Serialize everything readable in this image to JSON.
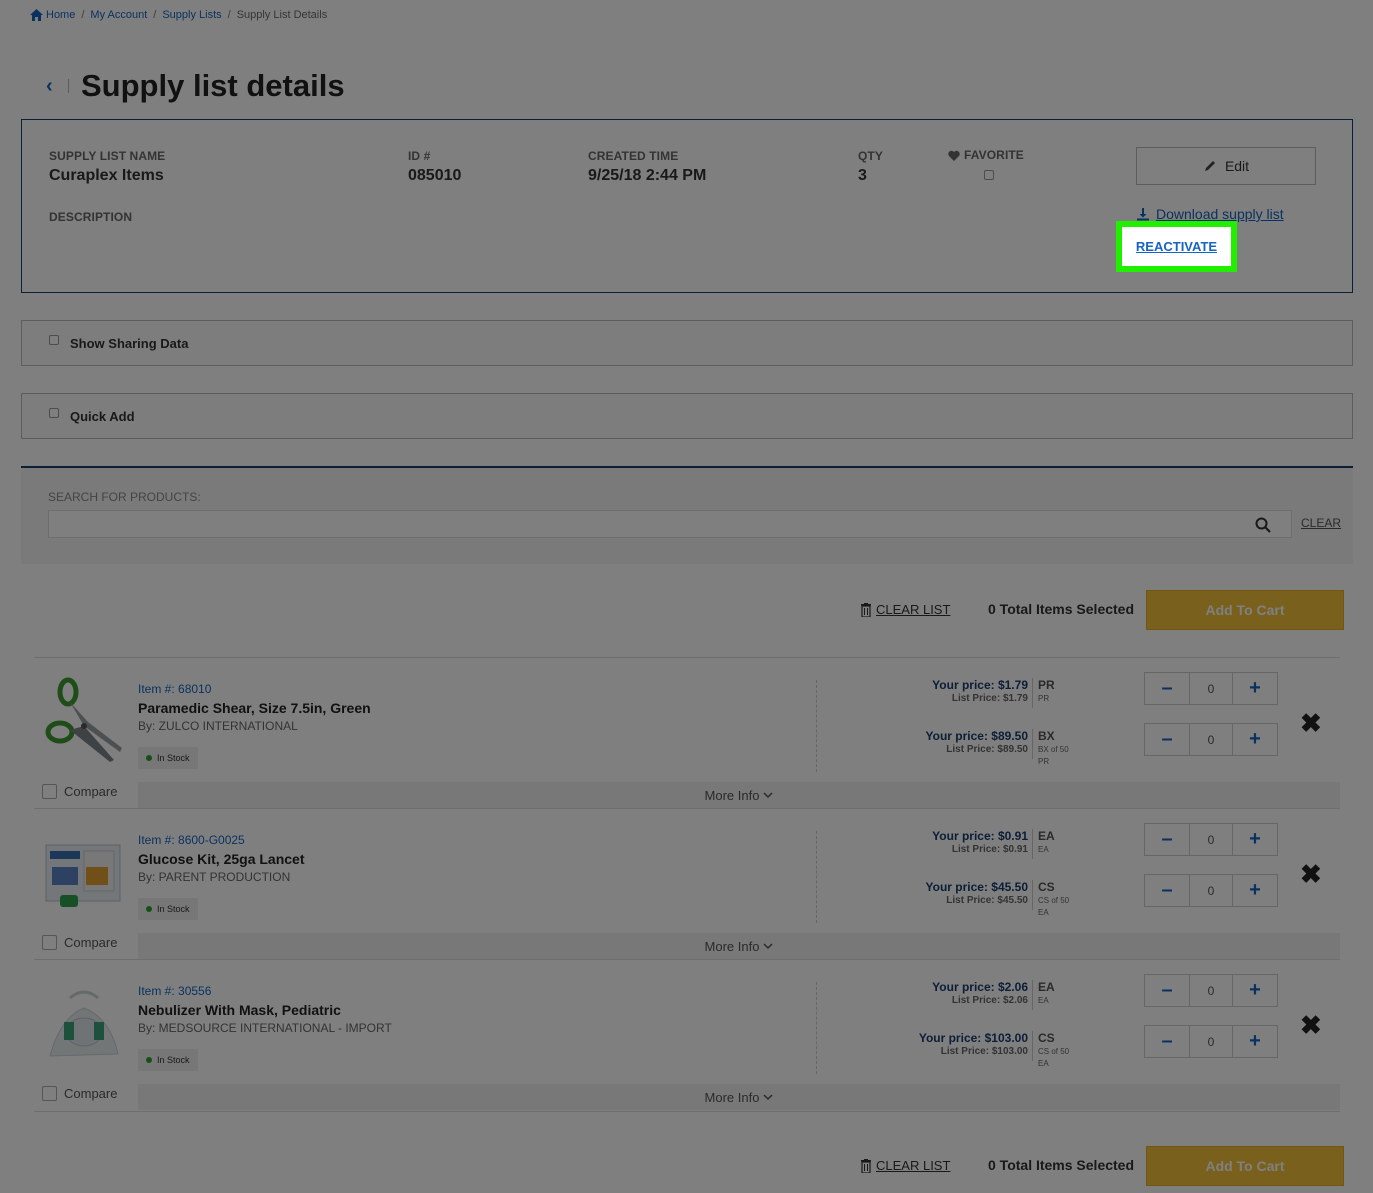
{
  "breadcrumb": {
    "home": "Home",
    "account": "My Account",
    "lists": "Supply Lists",
    "current": "Supply List Details"
  },
  "page": {
    "title": "Supply list details"
  },
  "list_info": {
    "name_label": "SUPPLY LIST NAME",
    "name": "Curaplex Items",
    "id_label": "ID #",
    "id": "085010",
    "created_label": "CREATED TIME",
    "created": "9/25/18 2:44 PM",
    "qty_label": "QTY",
    "qty": "3",
    "favorite_label": "FAVORITE",
    "description_label": "DESCRIPTION",
    "edit_label": "Edit",
    "download_label": "Download supply list",
    "reactivate_label": "REACTIVATE"
  },
  "panels": {
    "sharing_label": "Show Sharing Data",
    "quick_add_label": "Quick Add"
  },
  "search": {
    "label": "SEARCH FOR PRODUCTS:",
    "placeholder": "",
    "clear_label": "CLEAR"
  },
  "actions": {
    "clear_list": "CLEAR LIST",
    "total_selected": "0 Total Items Selected",
    "add_to_cart": "Add To Cart"
  },
  "items": [
    {
      "number": "Item #: 68010",
      "name": "Paramedic Shear, Size 7.5in, Green",
      "by": "By: ZULCO INTERNATIONAL",
      "stock": "In Stock",
      "compare": "Compare",
      "more_info": "More Info",
      "prices": [
        {
          "your": "Your price: $1.79",
          "list": "List Price: $1.79",
          "uom": "PR",
          "uom_sub": "PR",
          "qty": "0"
        },
        {
          "your": "Your price: $89.50",
          "list": "List Price: $89.50",
          "uom": "BX",
          "uom_sub": "BX of 50 PR",
          "qty": "0"
        }
      ]
    },
    {
      "number": "Item #: 8600-G0025",
      "name": "Glucose Kit, 25ga Lancet",
      "by": "By: PARENT PRODUCTION",
      "stock": "In Stock",
      "compare": "Compare",
      "more_info": "More Info",
      "prices": [
        {
          "your": "Your price: $0.91",
          "list": "List Price: $0.91",
          "uom": "EA",
          "uom_sub": "EA",
          "qty": "0"
        },
        {
          "your": "Your price: $45.50",
          "list": "List Price: $45.50",
          "uom": "CS",
          "uom_sub": "CS of 50 EA",
          "qty": "0"
        }
      ]
    },
    {
      "number": "Item #: 30556",
      "name": "Nebulizer With Mask, Pediatric",
      "by": "By: MEDSOURCE INTERNATIONAL - IMPORT",
      "stock": "In Stock",
      "compare": "Compare",
      "more_info": "More Info",
      "prices": [
        {
          "your": "Your price: $2.06",
          "list": "List Price: $2.06",
          "uom": "EA",
          "uom_sub": "EA",
          "qty": "0"
        },
        {
          "your": "Your price: $103.00",
          "list": "List Price: $103.00",
          "uom": "CS",
          "uom_sub": "CS of 50 EA",
          "qty": "0"
        }
      ]
    }
  ],
  "colors": {
    "brand_blue": "#1565c0",
    "navy": "#1a3c6e",
    "add_to_cart": "#f2c23a",
    "highlight": "#22ee00",
    "in_stock": "#2e9e2e"
  },
  "icons": [
    "home-icon",
    "back-chevron-icon",
    "pencil-icon",
    "heart-icon",
    "download-icon",
    "search-icon",
    "trash-icon",
    "minus-icon",
    "plus-icon",
    "close-x-icon",
    "chevron-down-icon"
  ]
}
